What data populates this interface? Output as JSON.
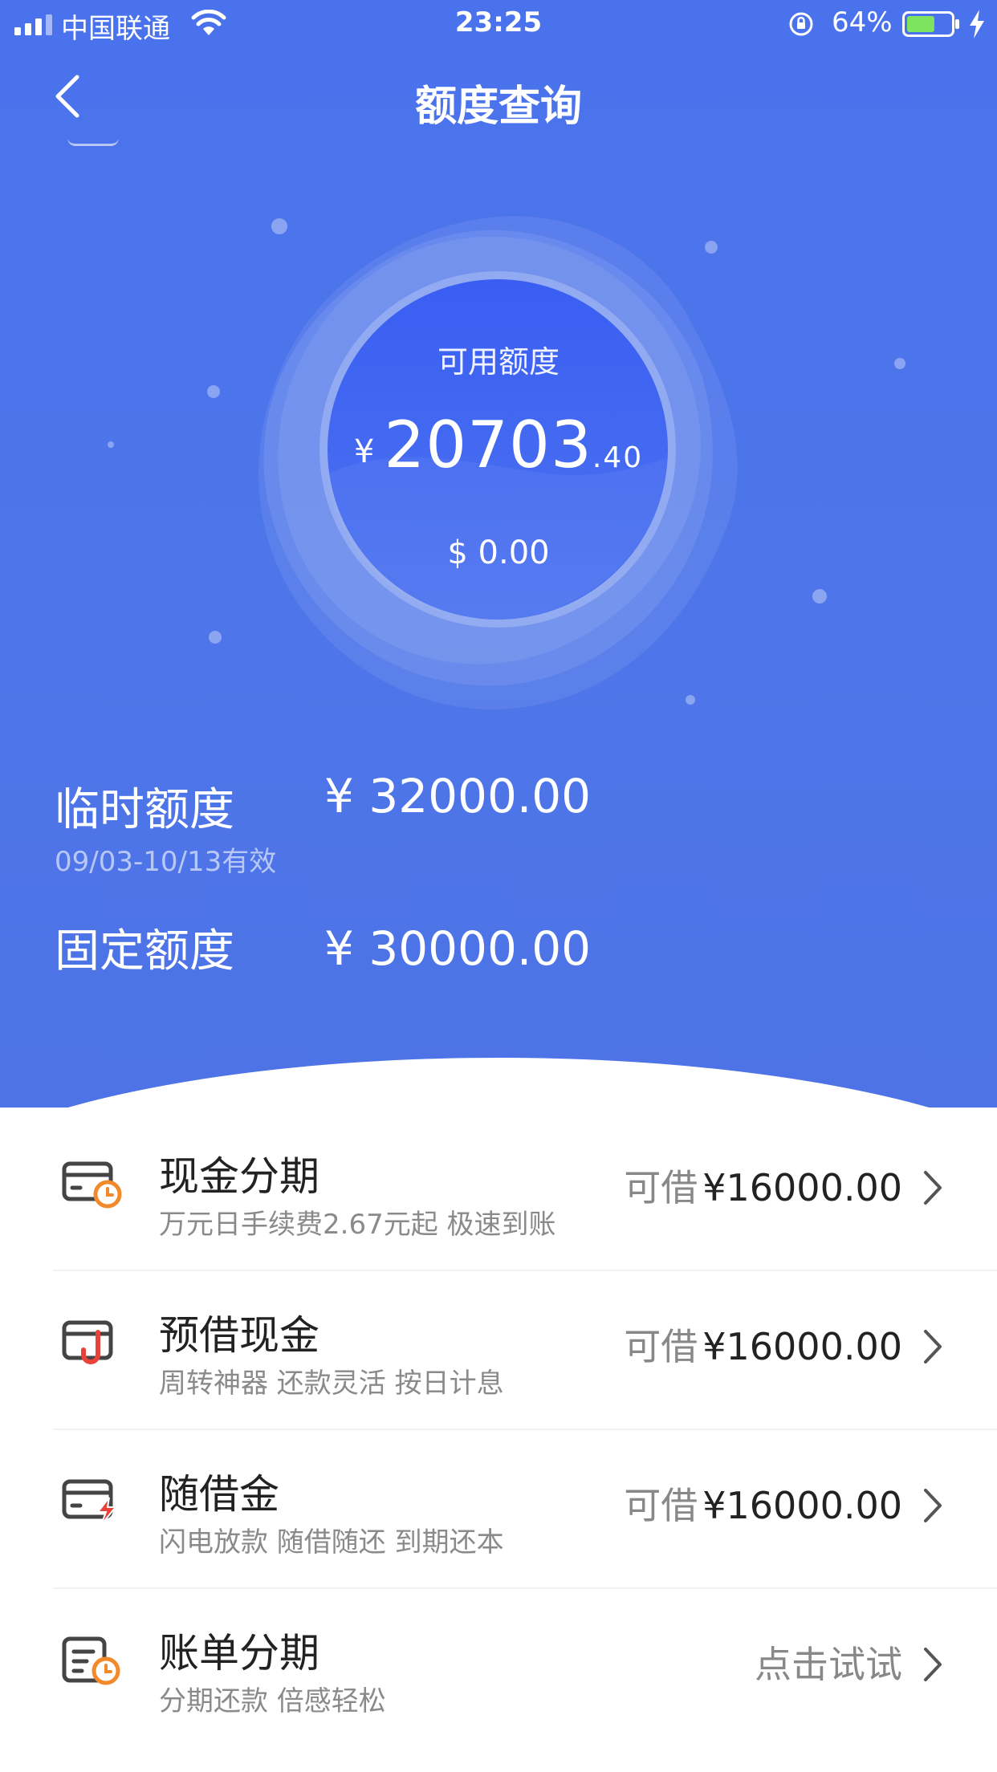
{
  "status_bar": {
    "carrier": "中国联通",
    "time": "23:25",
    "battery": "64%",
    "battery_level": 0.64
  },
  "nav": {
    "title": "额度查询"
  },
  "available": {
    "label": "可用额度",
    "currency_symbol": "¥",
    "integer": "20703",
    "decimal": ".40",
    "usd": "$ 0.00"
  },
  "limits": {
    "temporary": {
      "label": "临时额度",
      "value": "¥ 32000.00",
      "validity": "09/03-10/13有效"
    },
    "fixed": {
      "label": "固定额度",
      "value": "¥ 30000.00"
    }
  },
  "services": [
    {
      "icon": "card-clock-icon",
      "title": "现金分期",
      "subtitle": "万元日手续费2.67元起 极速到账",
      "prefix": "可借",
      "value": "¥16000.00"
    },
    {
      "icon": "card-hook-icon",
      "title": "预借现金",
      "subtitle": "周转神器 还款灵活 按日计息",
      "prefix": "可借",
      "value": "¥16000.00"
    },
    {
      "icon": "card-lightning-icon",
      "title": "随借金",
      "subtitle": "闪电放款 随借随还 到期还本",
      "prefix": "可借",
      "value": "¥16000.00"
    },
    {
      "icon": "bill-clock-icon",
      "title": "账单分期",
      "subtitle": "分期还款 倍感轻松",
      "action": "点击试试"
    }
  ],
  "colors": {
    "primary": "#4a72ec",
    "accent_orange": "#f28a2c",
    "accent_red": "#e8423a"
  }
}
